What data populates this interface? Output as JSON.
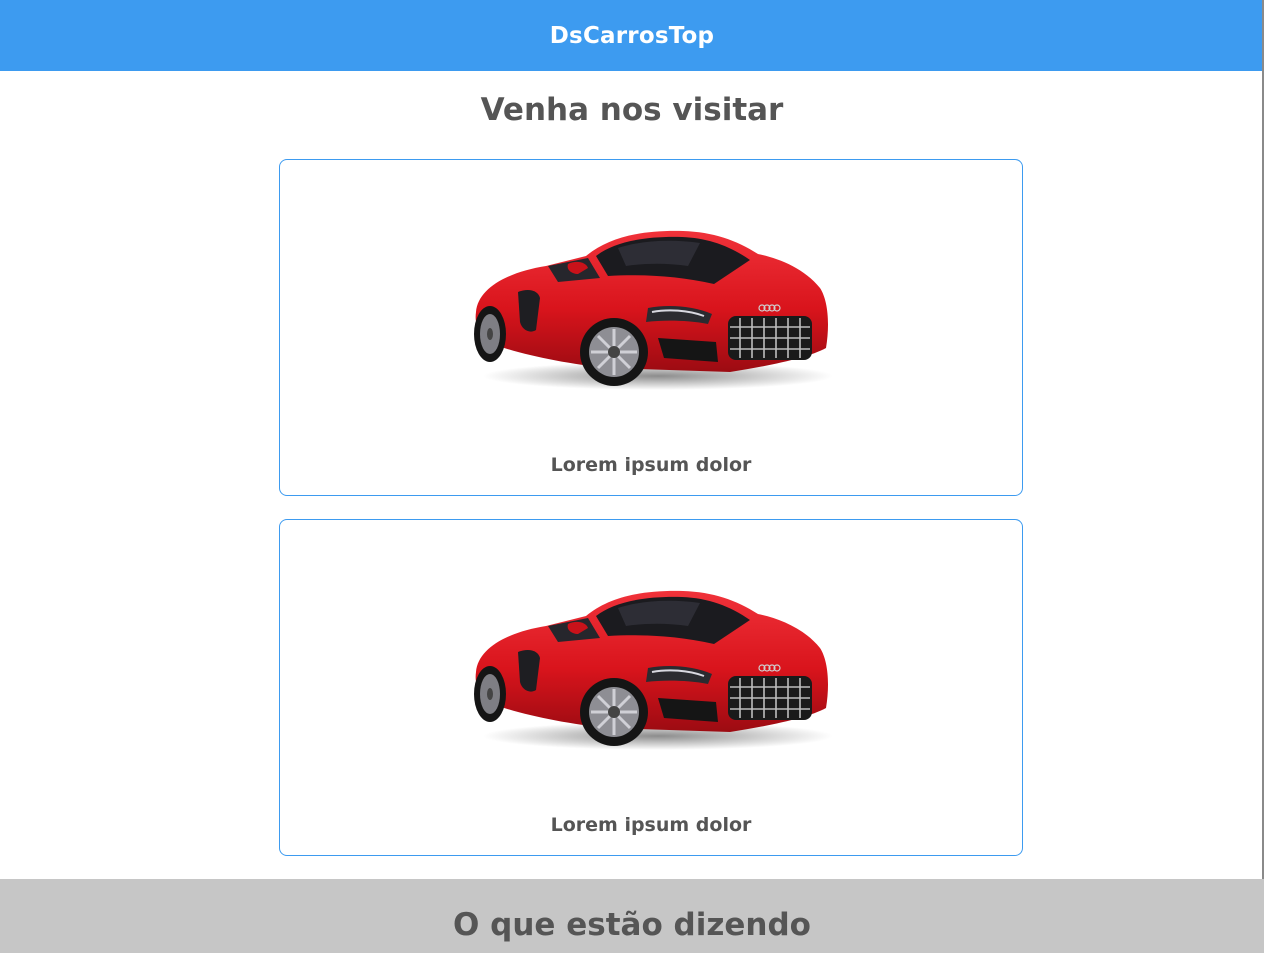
{
  "header": {
    "brand": "DsCarrosTop"
  },
  "visit": {
    "title": "Venha nos visitar",
    "cards": [
      {
        "label": "Lorem ipsum dolor",
        "image": "red-sports-car"
      },
      {
        "label": "Lorem ipsum dolor",
        "image": "red-sports-car"
      }
    ]
  },
  "testimonials": {
    "title": "O que estão dizendo"
  },
  "colors": {
    "header_bg": "#3d9bf0",
    "card_border": "#3d9bf0",
    "text": "#555555",
    "testimonials_bg": "#c6c6c6",
    "car_body": "#e0161e"
  }
}
